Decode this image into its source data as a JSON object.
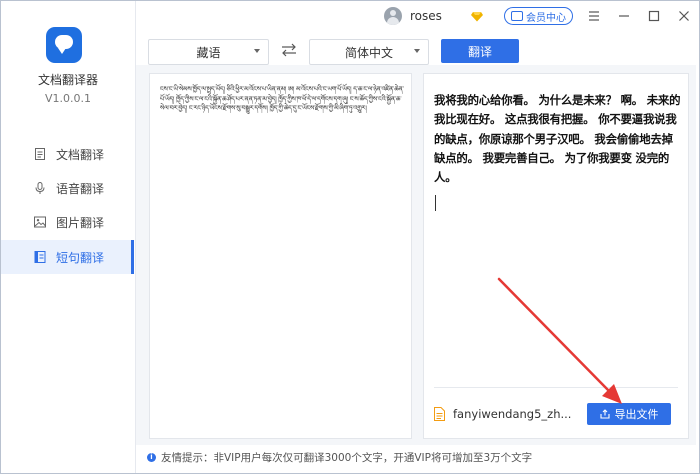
{
  "app": {
    "name": "文档翻译器",
    "version": "V1.0.0.1"
  },
  "sidebar": {
    "items": [
      {
        "label": "文档翻译",
        "icon": "document-icon",
        "active": false
      },
      {
        "label": "语音翻译",
        "icon": "microphone-icon",
        "active": false
      },
      {
        "label": "图片翻译",
        "icon": "image-icon",
        "active": false
      },
      {
        "label": "短句翻译",
        "icon": "text-icon",
        "active": true
      }
    ]
  },
  "header": {
    "username": "roses",
    "vip_label": "会员中心"
  },
  "toolbar": {
    "source_lang": "藏语",
    "target_lang": "简体中文",
    "translate_label": "翻译"
  },
  "source": {
    "text": "ངས་ང་ཡི་སེམས་ཁྱོད་ལ་སྤྲད་ཡོད། ཅིའི་ཕྱིར་མ་འོངས་པ་ཡིན་ནམ། ཨ། མ་འོངས་པའི་ང་ཡག་པོ་ཡོད། ད་ཆ་ང་ལ་ཉེན་འཛིན་ཆེན་པོ་ཡོད། ཁྱོད་ཀྱིས་ང་ལ་ངའི་སྐྱོན་ཆ་ཤོད་པར་ནན་ཏན་མ་བྱེད། ཁྱོད་ཀྱིས་ཁ་ཕོ་དེ་ལ་དགོངས་དག་ཞུ། ང་ས་ཆོད་ཀྱིས་ངའི་སྐྱོན་ཆ་སེལ་བར་བྱེད། ང་རང་ཉིད་ཡོངས་རྫོགས་སུ་བསྒྱུར་དགོས། ཁྱོད་ཀྱི་ཆེད་དུ་ང་ཡོངས་རྫོགས་ཀྱི་མི་ཞིག་ཏུ་འགྱུར།"
  },
  "output": {
    "text": "我将我的心给你看。 为什么是未来？ 啊。 未来的我比现在好。 这点我很有把握。 你不要逼我说我的缺点，你原谅那个男子汉吧。 我会偷偷地去掉缺点的。 我要完善自己。 为了你我要变 没完的人。",
    "file_name": "fanyiwendang5_zh...",
    "export_label": "导出文件"
  },
  "footer": {
    "tip": "友情提示：非VIP用户每次仅可翻译3000个文字，开通VIP将可增加至3万个文字"
  },
  "colors": {
    "accent": "#2f6fe6",
    "arrow": "#e53935",
    "diamond": "#f0b400"
  }
}
